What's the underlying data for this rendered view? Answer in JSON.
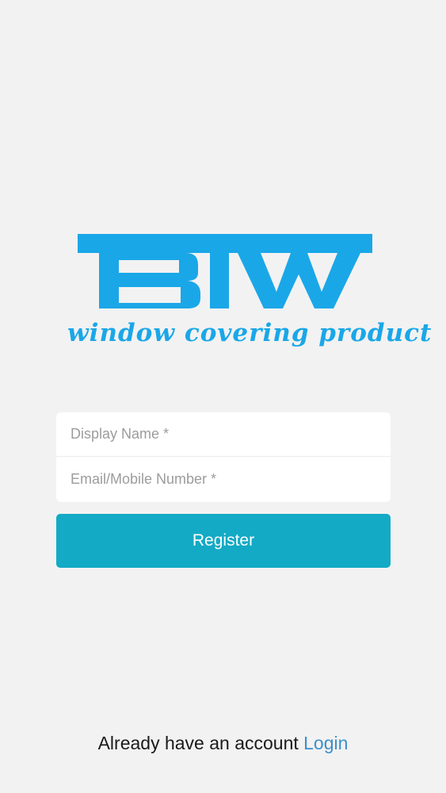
{
  "logo": {
    "letters": "BIW",
    "tagline": "window covering product",
    "brand_color": "#1aa7e8"
  },
  "form": {
    "display_name": {
      "placeholder": "Display Name *",
      "value": ""
    },
    "email_mobile": {
      "placeholder": "Email/Mobile Number *",
      "value": ""
    },
    "register_label": "Register",
    "button_color": "#13aac5"
  },
  "footer": {
    "prompt": "Already have an account",
    "login_label": "Login",
    "link_color": "#3d8fca"
  }
}
